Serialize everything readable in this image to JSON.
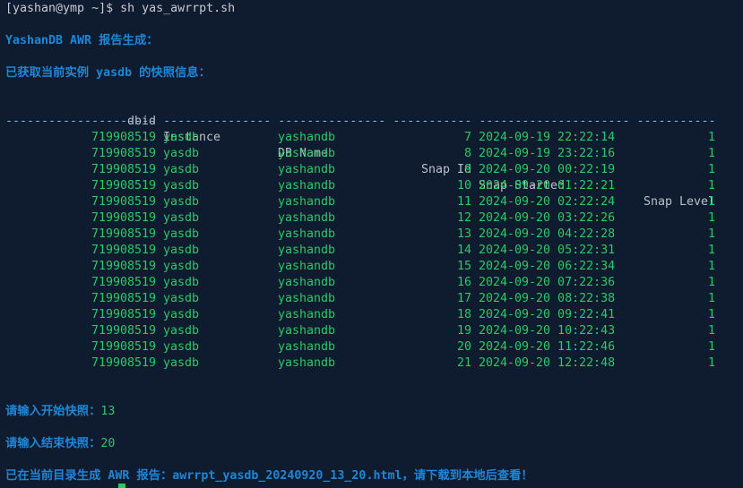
{
  "terminal": {
    "prompt_line": "[yashan@ymp ~]$ sh yas_awrrpt.sh",
    "title": "YashanDB AWR 报告生成：",
    "fetched_info": "已获取当前实例 yasdb 的快照信息：",
    "columns": {
      "dbid": "dbid",
      "instance": "Instance",
      "db_name": "DB Name",
      "snap_id": "Snap Id",
      "snap_started": "Snap Started",
      "snap_level": "Snap Level"
    },
    "separator": "--------------------- --------------- --------------- ----------- --------------------- -----------",
    "rows": [
      {
        "dbid": "719908519",
        "instance": "yasdb",
        "db_name": "yashandb",
        "snap_id": "7",
        "snap_started": "2024-09-19 22:22:14",
        "snap_level": "1"
      },
      {
        "dbid": "719908519",
        "instance": "yasdb",
        "db_name": "yashandb",
        "snap_id": "8",
        "snap_started": "2024-09-19 23:22:16",
        "snap_level": "1"
      },
      {
        "dbid": "719908519",
        "instance": "yasdb",
        "db_name": "yashandb",
        "snap_id": "9",
        "snap_started": "2024-09-20 00:22:19",
        "snap_level": "1"
      },
      {
        "dbid": "719908519",
        "instance": "yasdb",
        "db_name": "yashandb",
        "snap_id": "10",
        "snap_started": "2024-09-20 01:22:21",
        "snap_level": "1"
      },
      {
        "dbid": "719908519",
        "instance": "yasdb",
        "db_name": "yashandb",
        "snap_id": "11",
        "snap_started": "2024-09-20 02:22:24",
        "snap_level": "1"
      },
      {
        "dbid": "719908519",
        "instance": "yasdb",
        "db_name": "yashandb",
        "snap_id": "12",
        "snap_started": "2024-09-20 03:22:26",
        "snap_level": "1"
      },
      {
        "dbid": "719908519",
        "instance": "yasdb",
        "db_name": "yashandb",
        "snap_id": "13",
        "snap_started": "2024-09-20 04:22:28",
        "snap_level": "1"
      },
      {
        "dbid": "719908519",
        "instance": "yasdb",
        "db_name": "yashandb",
        "snap_id": "14",
        "snap_started": "2024-09-20 05:22:31",
        "snap_level": "1"
      },
      {
        "dbid": "719908519",
        "instance": "yasdb",
        "db_name": "yashandb",
        "snap_id": "15",
        "snap_started": "2024-09-20 06:22:34",
        "snap_level": "1"
      },
      {
        "dbid": "719908519",
        "instance": "yasdb",
        "db_name": "yashandb",
        "snap_id": "16",
        "snap_started": "2024-09-20 07:22:36",
        "snap_level": "1"
      },
      {
        "dbid": "719908519",
        "instance": "yasdb",
        "db_name": "yashandb",
        "snap_id": "17",
        "snap_started": "2024-09-20 08:22:38",
        "snap_level": "1"
      },
      {
        "dbid": "719908519",
        "instance": "yasdb",
        "db_name": "yashandb",
        "snap_id": "18",
        "snap_started": "2024-09-20 09:22:41",
        "snap_level": "1"
      },
      {
        "dbid": "719908519",
        "instance": "yasdb",
        "db_name": "yashandb",
        "snap_id": "19",
        "snap_started": "2024-09-20 10:22:43",
        "snap_level": "1"
      },
      {
        "dbid": "719908519",
        "instance": "yasdb",
        "db_name": "yashandb",
        "snap_id": "20",
        "snap_started": "2024-09-20 11:22:46",
        "snap_level": "1"
      },
      {
        "dbid": "719908519",
        "instance": "yasdb",
        "db_name": "yashandb",
        "snap_id": "21",
        "snap_started": "2024-09-20 12:22:48",
        "snap_level": "1"
      }
    ],
    "start_prompt": "请输入开始快照：",
    "start_value": "13",
    "end_prompt": "请输入结束快照：",
    "end_value": "20",
    "result_line": "已在当前目录生成 AWR 报告：awrrpt_yasdb_20240920_13_20.html，请下载到本地后查看！",
    "colors": {
      "background": "#0f1b2e",
      "heading_blue": "#1f86d6",
      "data_green": "#2ec866",
      "text_gray": "#c6cbd4"
    }
  }
}
